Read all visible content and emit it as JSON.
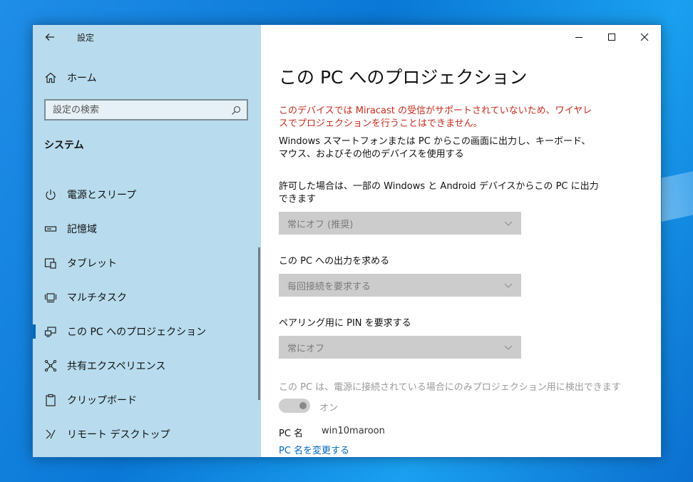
{
  "app": {
    "title": "設定"
  },
  "sidebar": {
    "home_label": "ホーム",
    "search_placeholder": "設定の検索",
    "section_title": "システム",
    "items": [
      {
        "label": "電源とスリープ",
        "icon": "power-icon"
      },
      {
        "label": "記憶域",
        "icon": "storage-icon"
      },
      {
        "label": "タブレット",
        "icon": "tablet-icon"
      },
      {
        "label": "マルチタスク",
        "icon": "multitasking-icon"
      },
      {
        "label": "この PC へのプロジェクション",
        "icon": "projection-icon",
        "active": true
      },
      {
        "label": "共有エクスペリエンス",
        "icon": "shared-experiences-icon"
      },
      {
        "label": "クリップボード",
        "icon": "clipboard-icon"
      },
      {
        "label": "リモート デスクトップ",
        "icon": "remote-desktop-icon"
      }
    ]
  },
  "main": {
    "title": "この PC へのプロジェクション",
    "warning": "このデバイスでは Miracast の受信がサポートされていないため、ワイヤレスでプロジェクションを行うことはできません。",
    "description": "Windows スマートフォンまたは PC からこの画面に出力し、キーボード、マウス、およびその他のデバイスを使用する",
    "setting1_label": "許可した場合は、一部の Windows と Android デバイスからこの PC に出力できます",
    "setting1_value": "常にオフ (推奨)",
    "setting2_label": "この PC への出力を求める",
    "setting2_value": "毎回接続を要求する",
    "setting3_label": "ペアリング用に PIN を要求する",
    "setting3_value": "常にオフ",
    "power_note": "この PC は、電源に接続されている場合にのみプロジェクション用に検出できます",
    "toggle_state": "オン",
    "pc_name_label": "PC 名",
    "pc_name_value": "win10maroon",
    "rename_link": "PC 名を変更する"
  },
  "colors": {
    "sidebar_bg": "#b8dcee",
    "accent": "#0067c0",
    "warning": "#c42b1c",
    "disabled_dropdown": "#cccccc"
  }
}
